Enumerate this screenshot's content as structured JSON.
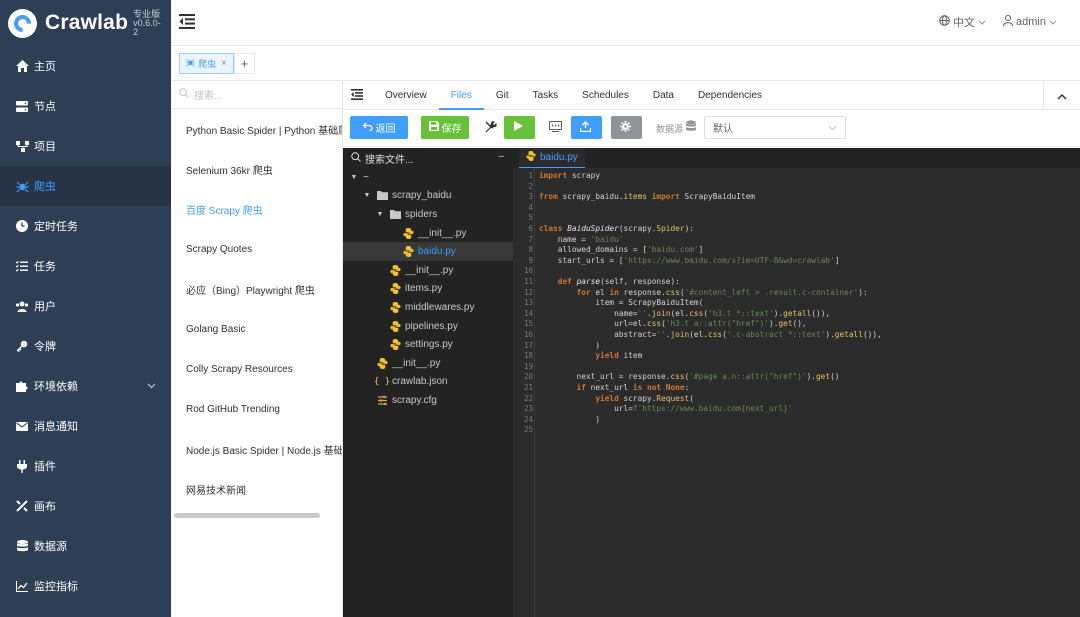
{
  "app": {
    "name": "Crawlab",
    "edition_lines": [
      "专业版",
      "v0.6.0-",
      "2"
    ]
  },
  "sidebar": {
    "items": [
      {
        "label": "主页",
        "icon": "home-icon"
      },
      {
        "label": "节点",
        "icon": "server-icon"
      },
      {
        "label": "项目",
        "icon": "project-icon"
      },
      {
        "label": "爬虫",
        "icon": "spider-icon",
        "active": true
      },
      {
        "label": "定时任务",
        "icon": "clock-icon"
      },
      {
        "label": "任务",
        "icon": "task-list-icon"
      },
      {
        "label": "用户",
        "icon": "users-icon"
      },
      {
        "label": "令牌",
        "icon": "key-icon"
      },
      {
        "label": "环境依赖",
        "icon": "puzzle-icon",
        "has_arrow": true
      },
      {
        "label": "消息通知",
        "icon": "envelope-icon"
      },
      {
        "label": "插件",
        "icon": "plug-icon"
      },
      {
        "label": "画布",
        "icon": "tools-icon"
      },
      {
        "label": "数据源",
        "icon": "database-icon"
      },
      {
        "label": "监控指标",
        "icon": "chart-icon"
      }
    ]
  },
  "header": {
    "language": "中文",
    "user": "admin"
  },
  "page_tabs": {
    "active_label": "爬虫",
    "close": "×",
    "add": "+"
  },
  "spider_list": {
    "search_placeholder": "搜索...",
    "items": [
      "Python Basic Spider | Python 基础爬虫",
      "Selenium 36kr 爬虫",
      "百度 Scrapy 爬虫",
      "Scrapy Quotes",
      "必应（Bing）Playwright 爬虫",
      "Golang Basic",
      "Colly Scrapy Resources",
      "Rod GitHub Trending",
      "Node.js Basic Spider | Node.js 基础爬虫",
      "网易技术新闻"
    ],
    "active_index": 2
  },
  "detail": {
    "tabs": [
      "Overview",
      "Files",
      "Git",
      "Tasks",
      "Schedules",
      "Data",
      "Dependencies"
    ],
    "active_tab": "Files",
    "toolbar": {
      "back_label": "返回",
      "save_label": "保存",
      "datasource_label": "数据源",
      "datasource_value": "默认"
    }
  },
  "file_tree": {
    "search_placeholder": "搜索文件...",
    "collapse": "–",
    "rows": [
      {
        "name": "~",
        "type": "folder",
        "depth": 0,
        "expanded": true
      },
      {
        "name": "scrapy_baidu",
        "type": "folder",
        "depth": 1,
        "expanded": true
      },
      {
        "name": "spiders",
        "type": "folder",
        "depth": 2,
        "expanded": true
      },
      {
        "name": "__init__.py",
        "type": "python",
        "depth": 3
      },
      {
        "name": "baidu.py",
        "type": "python",
        "depth": 3,
        "selected": true
      },
      {
        "name": "__init__.py",
        "type": "python",
        "depth": 2
      },
      {
        "name": "items.py",
        "type": "python",
        "depth": 2
      },
      {
        "name": "middlewares.py",
        "type": "python",
        "depth": 2
      },
      {
        "name": "pipelines.py",
        "type": "python",
        "depth": 2
      },
      {
        "name": "settings.py",
        "type": "python",
        "depth": 2
      },
      {
        "name": "__init__.py",
        "type": "python",
        "depth": 1
      },
      {
        "name": "crawlab.json",
        "type": "json",
        "depth": 1
      },
      {
        "name": "scrapy.cfg",
        "type": "cfg",
        "depth": 1
      }
    ]
  },
  "editor": {
    "open_file": "baidu.py",
    "lines": [
      "import scrapy",
      "",
      "from scrapy_baidu.items import ScrapyBaiduItem",
      "",
      "",
      "class BaiduSpider(scrapy.Spider):",
      "    name = 'baidu'",
      "    allowed_domains = ['baidu.com']",
      "    start_urls = ['https://www.baidu.com/s?ie=UTF-8&wd=crawlab']",
      "",
      "    def parse(self, response):",
      "        for el in response.css('#content_left > .result.c-container'):",
      "            item = ScrapyBaiduItem(",
      "                name=''.join(el.css('h3.t *::text').getall()),",
      "                url=el.css('h3.t a::attr(\"href\")').get(),",
      "                abstract=''.join(el.css('.c-abstract *::text').getall()),",
      "            )",
      "            yield item",
      "",
      "        next_url = response.css('#page a.n::attr(\"href\")').get()",
      "        if next_url is not None:",
      "            yield scrapy.Request(",
      "                url=f'https://www.baidu.com{next_url}'",
      "            )",
      ""
    ]
  },
  "colors": {
    "sidebar_bg": "#2e3e54",
    "accent": "#409eff",
    "success": "#67c23a",
    "info": "#909399",
    "editor_bg": "#2b2b2b"
  }
}
